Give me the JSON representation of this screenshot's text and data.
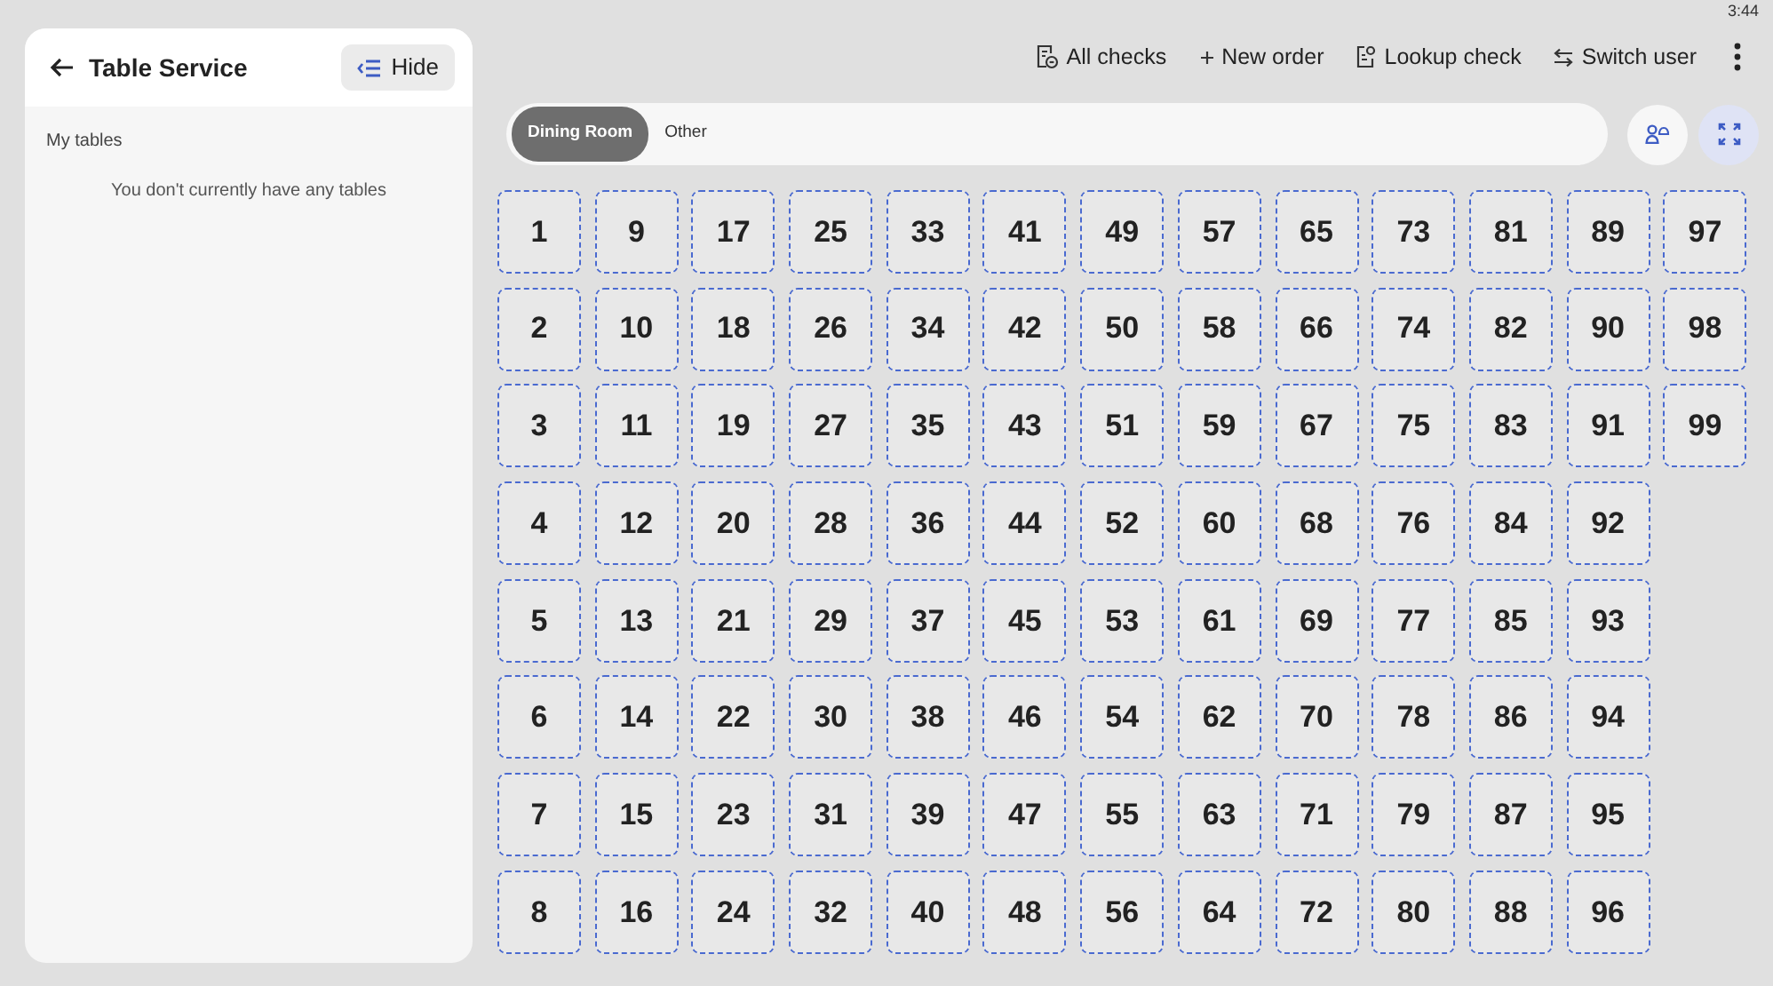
{
  "status_bar": {
    "time": "3:44"
  },
  "side_panel": {
    "title": "Table Service",
    "hide_button": "Hide",
    "section_label": "My tables",
    "empty_message": "You don't currently have any tables"
  },
  "toolbar": [
    "All checks",
    "New order",
    "Lookup check",
    "Switch user"
  ],
  "tabs": [
    {
      "label": "Dining Room",
      "selected": true
    },
    {
      "label": "Other",
      "selected": false
    }
  ],
  "tables": [
    "1",
    "2",
    "3",
    "4",
    "5",
    "6",
    "7",
    "8",
    "9",
    "10",
    "11",
    "12",
    "13",
    "14",
    "15",
    "16",
    "17",
    "18",
    "19",
    "20",
    "21",
    "22",
    "23",
    "24",
    "25",
    "26",
    "27",
    "28",
    "29",
    "30",
    "31",
    "32",
    "33",
    "34",
    "35",
    "36",
    "37",
    "38",
    "39",
    "40",
    "41",
    "42",
    "43",
    "44",
    "45",
    "46",
    "47",
    "48",
    "49",
    "50",
    "51",
    "52",
    "53",
    "54",
    "55",
    "56",
    "57",
    "58",
    "59",
    "60",
    "61",
    "62",
    "63",
    "64",
    "65",
    "66",
    "67",
    "68",
    "69",
    "70",
    "71",
    "72",
    "73",
    "74",
    "75",
    "76",
    "77",
    "78",
    "79",
    "80",
    "81",
    "82",
    "83",
    "84",
    "85",
    "86",
    "87",
    "88",
    "89",
    "90",
    "91",
    "92",
    "93",
    "94",
    "95",
    "96",
    "97",
    "98",
    "99"
  ]
}
